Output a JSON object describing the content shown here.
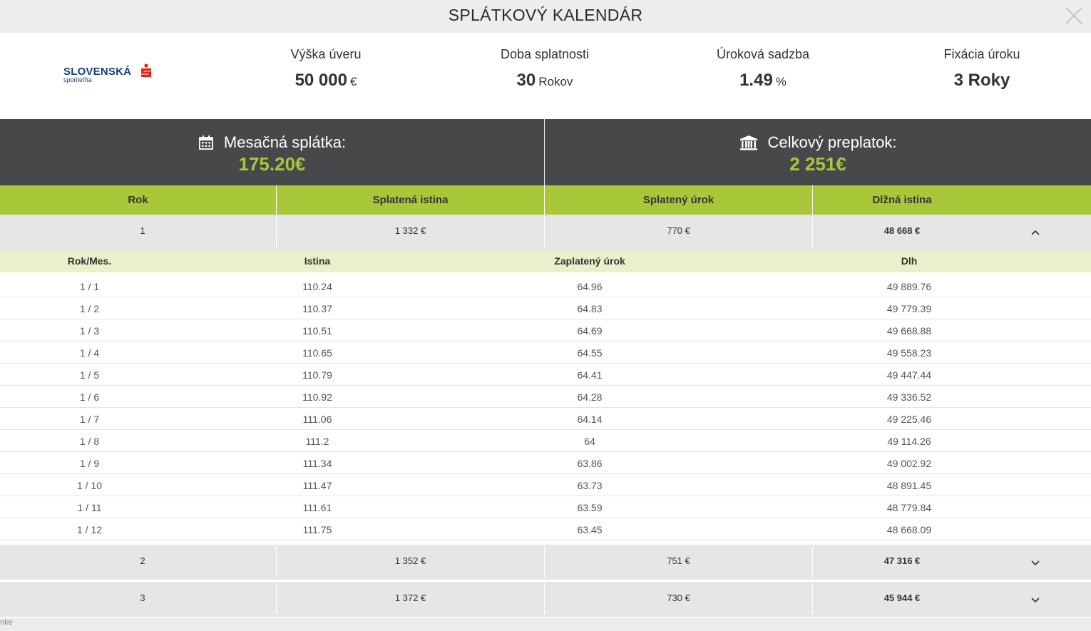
{
  "title": "SPLÁTKOVÝ KALENDÁR",
  "bank": {
    "name": "SLOVENSKÁ",
    "sub": "sporiteľňa"
  },
  "summary": [
    {
      "label": "Výška úveru",
      "value": "50 000",
      "unit": "€"
    },
    {
      "label": "Doba splatnosti",
      "value": "30",
      "unit": "Rokov"
    },
    {
      "label": "Úroková sadzba",
      "value": "1.49",
      "unit": "%"
    },
    {
      "label": "Fixácia úroku",
      "value": "3 Roky",
      "unit": ""
    }
  ],
  "monthly": {
    "label": "Mesačná splátka:",
    "amount": "175.20€"
  },
  "overpay": {
    "label": "Celkový preplatok:",
    "amount": "2 251€"
  },
  "table_headers": [
    "Rok",
    "Splatená istina",
    "Splatený úrok",
    "Dlžná istina"
  ],
  "years": [
    {
      "year": "1",
      "principal": "1 332 €",
      "interest": "770 €",
      "remaining": "48 668 €",
      "expanded": true
    },
    {
      "year": "2",
      "principal": "1 352 €",
      "interest": "751 €",
      "remaining": "47 316 €",
      "expanded": false
    },
    {
      "year": "3",
      "principal": "1 372 €",
      "interest": "730 €",
      "remaining": "45 944 €",
      "expanded": false
    }
  ],
  "month_headers": [
    "Rok/Mes.",
    "Istina",
    "Zaplatený úrok",
    "Dlh"
  ],
  "months": [
    [
      "1 / 1",
      "110.24",
      "64.96",
      "49 889.76"
    ],
    [
      "1 / 2",
      "110.37",
      "64.83",
      "49 779.39"
    ],
    [
      "1 / 3",
      "110.51",
      "64.69",
      "49 668.88"
    ],
    [
      "1 / 4",
      "110.65",
      "64.55",
      "49 558.23"
    ],
    [
      "1 / 5",
      "110.79",
      "64.41",
      "49 447.44"
    ],
    [
      "1 / 6",
      "110.92",
      "64.28",
      "49 336.52"
    ],
    [
      "1 / 7",
      "111.06",
      "64.14",
      "49 225.46"
    ],
    [
      "1 / 8",
      "111.2",
      "64",
      "49 114.26"
    ],
    [
      "1 / 9",
      "111.34",
      "63.86",
      "49 002.92"
    ],
    [
      "1 / 10",
      "111.47",
      "63.73",
      "48 891.45"
    ],
    [
      "1 / 11",
      "111.61",
      "63.59",
      "48 779.84"
    ],
    [
      "1 / 12",
      "111.75",
      "63.45",
      "48 668.09"
    ]
  ],
  "footer_fragment": "nke",
  "colors": {
    "accent_green": "#a8c83a",
    "dark_band": "#47484a",
    "light_green": "#e8f0cc",
    "row_gray": "#e6e6e7"
  }
}
